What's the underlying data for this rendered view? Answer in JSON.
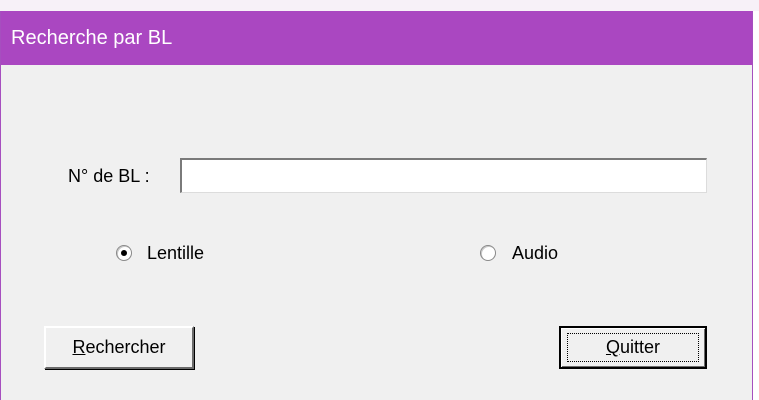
{
  "window": {
    "title": "Recherche par BL"
  },
  "form": {
    "bl_label": "N° de BL :",
    "bl_value": "",
    "bl_placeholder": ""
  },
  "options": {
    "lentille": {
      "label": "Lentille",
      "checked": true
    },
    "audio": {
      "label": "Audio",
      "checked": false
    }
  },
  "buttons": {
    "rechercher": {
      "mnemonic": "R",
      "rest": "echercher"
    },
    "quitter": {
      "mnemonic": "Q",
      "rest": "uitter"
    }
  },
  "colors": {
    "titlebar": "#aa47c1",
    "dialog_bg": "#f0f0f0"
  }
}
